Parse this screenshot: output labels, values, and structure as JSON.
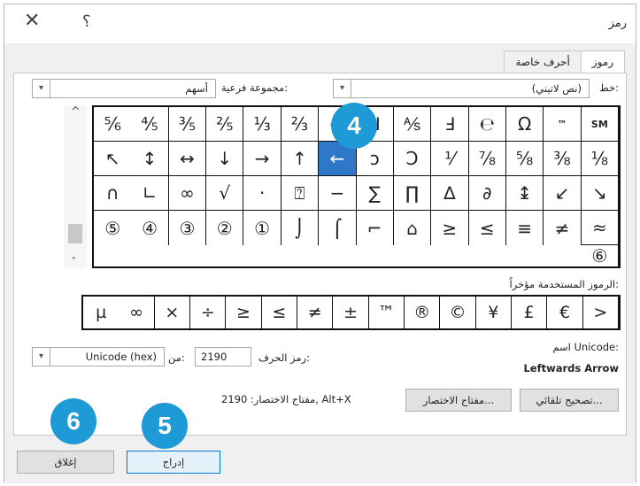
{
  "window": {
    "title": "رمز",
    "close_glyph": "✕",
    "help_glyph": "؟"
  },
  "tabs": [
    {
      "label": "رموز"
    },
    {
      "label": "أحرف خاصة"
    }
  ],
  "font": {
    "label": "خط:",
    "value": "(نص لاتيني)"
  },
  "subset": {
    "label": "مجموعة فرعية:",
    "value": "أسهم"
  },
  "symbols": [
    "SM",
    "™",
    "Ω",
    "℮",
    "Ⅎ",
    "⅍",
    "Ⅎ",
    "←",
    "⅔",
    "⅓",
    "⅖",
    "⅗",
    "⅘",
    "⅚",
    "⅛",
    "⅜",
    "⅝",
    "⅞",
    "⅟",
    "Ↄ",
    "ↄ",
    "←",
    "↑",
    "→",
    "↓",
    "↔",
    "↕",
    "↖",
    "↘",
    "↙",
    "↨",
    "∂",
    "∆",
    "∏",
    "∑",
    "−",
    "⍰",
    "·",
    "√",
    "∞",
    "∟",
    "∩",
    "≈",
    "≠",
    "≡",
    "≥",
    "≤",
    "⌂",
    "⌐",
    "⌠",
    "⌡",
    "①",
    "②",
    "③",
    "④",
    "⑤"
  ],
  "grid_extra": {
    "last_row_tail": "⑥",
    "selected_index": 21
  },
  "recent_label": "الرموز المستخدمة مؤخراً:",
  "recent": [
    "<",
    "€",
    "£",
    "¥",
    "©",
    "®",
    "™",
    "±",
    "≠",
    "≥",
    "≤",
    "÷",
    "×",
    "∞",
    "µ"
  ],
  "unicode": {
    "name_label": "اسم Unicode:",
    "name_value": "Leftwards Arrow",
    "code_label": "رمز الحرف:",
    "code_value": "2190",
    "from_label": "من:",
    "from_value": "Unicode (hex)"
  },
  "buttons": {
    "autocorrect": "تصحيح تلقائي...",
    "shortcut_key": "مفتاح الاختصار...",
    "shortcut_text": "مفتاح الاختصار: 2190, Alt+X",
    "insert": "إدراج",
    "close": "إغلاق"
  },
  "badges": {
    "b4": "4",
    "b5": "5",
    "b6": "6"
  },
  "colors": {
    "selection": "#2f78c9",
    "badge": "#1e9ad6"
  }
}
